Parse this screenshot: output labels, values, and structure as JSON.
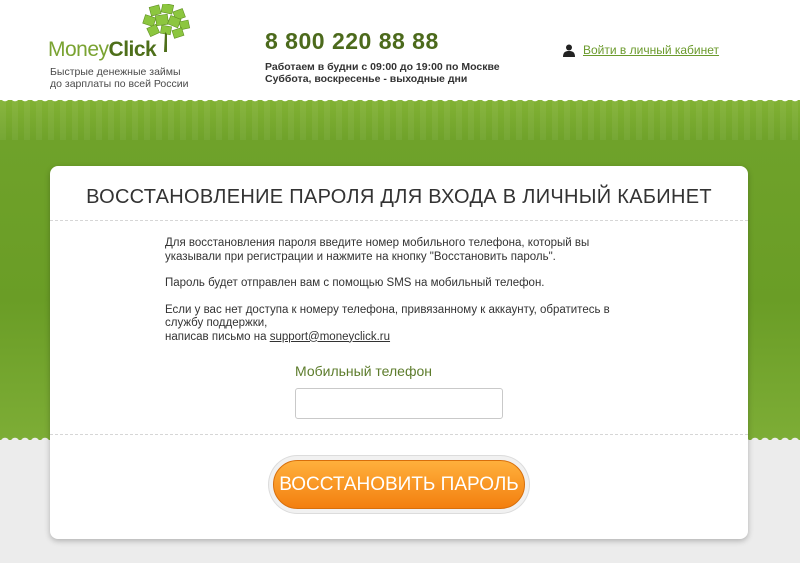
{
  "header": {
    "logo": {
      "money": "Money",
      "click": "Click",
      "tagline_line1": "Быстрые денежные займы",
      "tagline_line2": "до зарплаты по всей России"
    },
    "phone": "8 800 220 88 88",
    "hours_line1": "Работаем в будни с 09:00 до 19:00 по Москве",
    "hours_line2": "Суббота, воскресенье - выходные дни",
    "login_link": "Войти в личный кабинет"
  },
  "card": {
    "title": "ВОССТАНОВЛЕНИЕ ПАРОЛЯ ДЛЯ ВХОДА В ЛИЧНЫЙ КАБИНЕТ",
    "paragraph1": "Для восстановления пароля введите номер мобильного телефона, который вы указывали при регистрации и нажмите на кнопку \"Восстановить пароль\".",
    "paragraph2": "Пароль будет отправлен вам с помощью SMS на мобильный телефон.",
    "paragraph3": "Если у вас нет доступа к номеру телефона, привязанному к аккаунту, обратитесь в службу поддержки,",
    "paragraph3_line2_prefix": "написав письмо на ",
    "support_email": "support@moneyclick.ru",
    "phone_label": "Мобильный телефон",
    "phone_value": "",
    "submit_label": "ВОССТАНОВИТЬ ПАРОЛЬ"
  },
  "colors": {
    "brand_green": "#6a9d26",
    "accent_orange": "#f37f0f",
    "link_green": "#6b9a2c"
  },
  "icons": {
    "user": "user-icon",
    "logo_tree": "logo-tree-icon"
  }
}
